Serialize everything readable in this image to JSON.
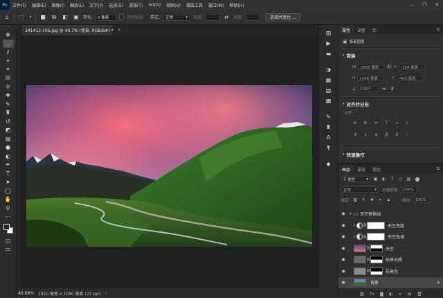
{
  "menubar": {
    "logo": "Ps",
    "items": [
      "文件(F)",
      "编辑(E)",
      "图像(I)",
      "图层(L)",
      "文字(Y)",
      "选择(S)",
      "滤镜(T)",
      "3D(D)",
      "视图(V)",
      "增效工具",
      "窗口(W)",
      "帮助(H)"
    ],
    "controls": [
      "—",
      "❐",
      "✕"
    ]
  },
  "options": {
    "feather_label": "羽化:",
    "feather_value": "0 像素",
    "antialias_label": "消除锯齿",
    "style_label": "样式:",
    "style_value": "正常",
    "width_label": "宽度:",
    "height_label": "高度:",
    "select_mask_button": "选择并遮住 ..."
  },
  "document": {
    "tab_title": "341413-106.jpg @ 40.7% (背景, RGB/8#) *",
    "tab_close": "×"
  },
  "status": {
    "zoom": "40.68%",
    "info": "1920 像素 x 1080 像素 (72 ppi)",
    "arrow": "›"
  },
  "properties": {
    "tabs": [
      "属性",
      "调整",
      "库"
    ],
    "pixel_layer_label": "像素图层",
    "transform_heading": "变换",
    "w_label": "W",
    "w_value": "2688 像素",
    "x_label": "X",
    "x_value": "-384 像素",
    "h_label": "H",
    "h_value": "1496 像素",
    "y_label": "Y",
    "y_value": "-400 像素",
    "angle_value": "0.00°",
    "align_heading": "对齐并分布",
    "align_label": "对齐:",
    "quick_heading": "快速操作"
  },
  "layers": {
    "tabs": [
      "图层",
      "通道",
      "路径"
    ],
    "filter_kind": "类型",
    "blend_mode": "正常",
    "opacity_label": "不透明度:",
    "opacity_value": "100%",
    "lock_label": "锁定:",
    "fill_label": "填充:",
    "fill_value": "100%",
    "items": [
      {
        "name": "天空替换组"
      },
      {
        "name": "天空亮度"
      },
      {
        "name": "天空色调"
      },
      {
        "name": "天空"
      },
      {
        "name": "前景光照"
      },
      {
        "name": "前景色"
      },
      {
        "name": "背景"
      }
    ]
  },
  "colors": {
    "accent": "#31a8ff",
    "panel_bg": "#2f2f2f",
    "canvas_bg": "#202020"
  }
}
